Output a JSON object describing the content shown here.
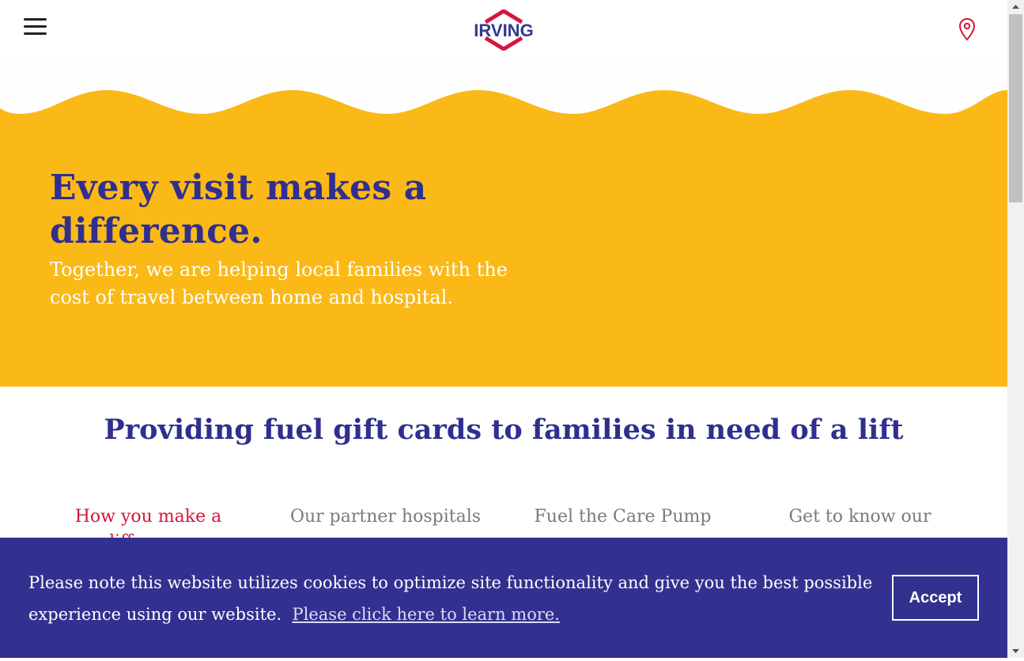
{
  "header": {
    "logo_text": "IRVING",
    "icons": {
      "menu": "hamburger-menu-icon",
      "location": "location-pin-icon"
    },
    "colors": {
      "logo_blue": "#2f3b8f",
      "logo_red": "#d4173c",
      "pin": "#d4173c"
    }
  },
  "hero": {
    "title": "Every visit makes a difference.",
    "subtitle": "Together, we are helping local families with the cost of travel between home and hospital.",
    "background_color": "#fab916",
    "title_color": "#2f2f8f"
  },
  "section": {
    "title": "Providing fuel gift cards to families in need of a lift"
  },
  "tabs": [
    {
      "label": "How you make a difference",
      "active": true
    },
    {
      "label": "Our partner hospitals",
      "active": false
    },
    {
      "label": "Fuel the Care Pump",
      "active": false
    },
    {
      "label": "Get to know our",
      "active": false
    }
  ],
  "cookie_banner": {
    "message": "Please note this website utilizes cookies to optimize site functionality and give you the best possible experience using our website.",
    "link_text": "Please click here to learn more.",
    "accept_label": "Accept",
    "background_color": "#32318f"
  }
}
